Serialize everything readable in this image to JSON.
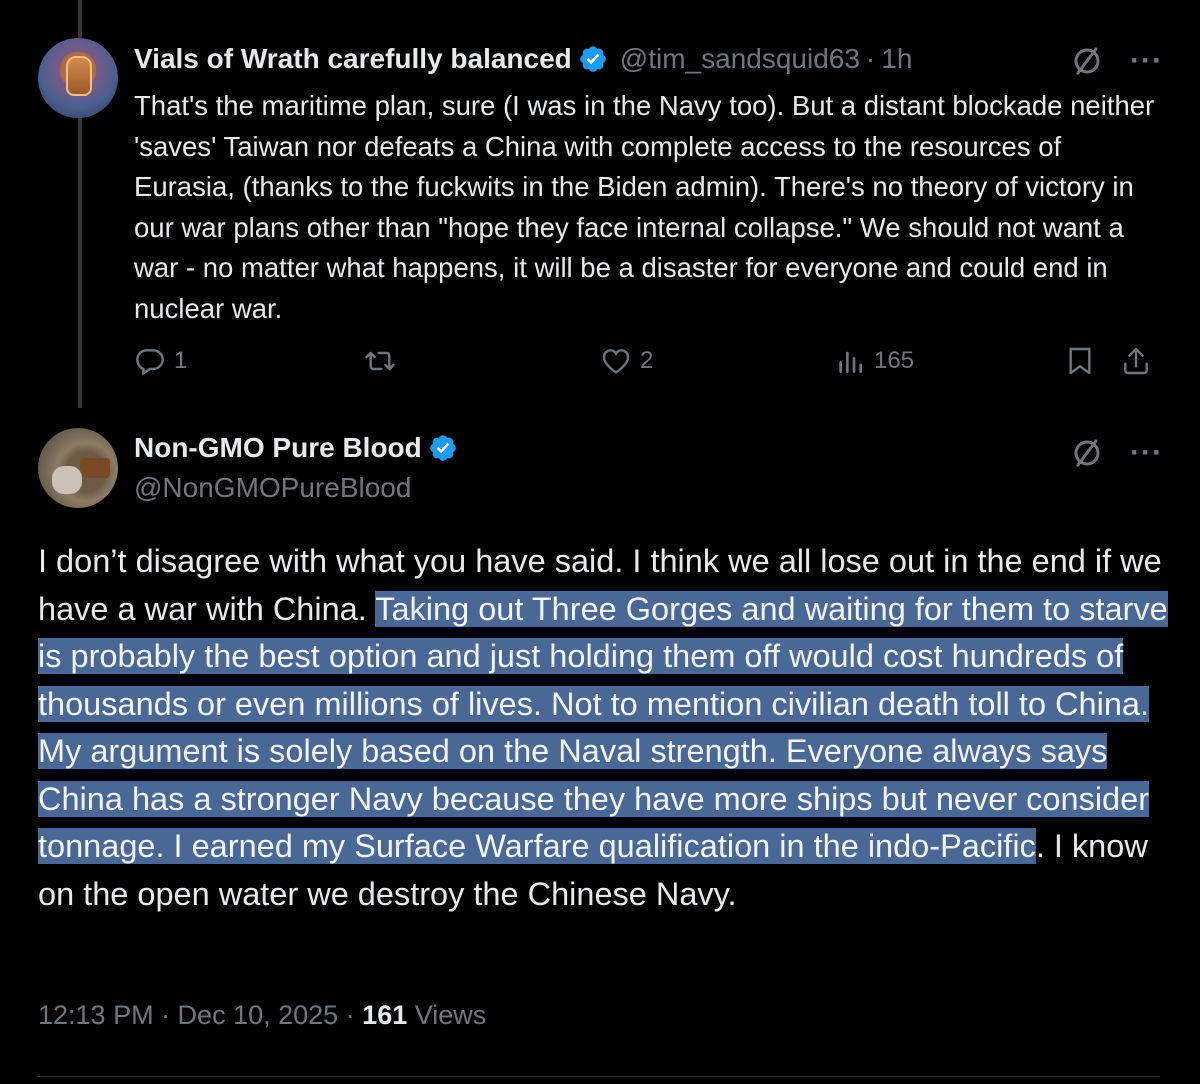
{
  "colors": {
    "background": "#000000",
    "text": "#e7e9ea",
    "muted": "#71767b",
    "verified_blue": "#1d9bf0",
    "highlight": "#4a6896"
  },
  "tweet1": {
    "author_name": "Vials of Wrath carefully balanced",
    "handle": "@tim_sandsquid63",
    "separator": "·",
    "time": "1h",
    "body": "That's the maritime plan, sure (I was in the Navy too). But a distant blockade neither 'saves' Taiwan nor defeats a China with complete access to the resources of Eurasia, (thanks to the fuckwits in the Biden admin). There's no theory of victory in our war plans other than \"hope they face internal collapse.\" We should not want a war - no matter what happens, it will be a disaster for everyone and could end in nuclear war.",
    "more": "···",
    "actions": {
      "reply_icon": "reply-icon",
      "replies": "1",
      "retweet_icon": "retweet-icon",
      "like_icon": "heart-icon",
      "likes": "2",
      "views_icon": "views-chart-icon",
      "views": "165",
      "bookmark_icon": "bookmark-icon",
      "share_icon": "share-icon"
    }
  },
  "tweet2": {
    "author_name": "Non-GMO Pure Blood",
    "handle": "@NonGMOPureBlood",
    "more": "···",
    "body_plain": "I don’t disagree with what you have said. I think we all lose out in the end if we have a war with China. ",
    "body_highlighted": "Taking out Three Gorges and waiting for them to starve is probably the best option and just holding them off would cost hundreds of thousands or even millions of lives. Not to mention civilian death toll to China.  My argument is solely based on the Naval strength. Everyone always says China has a stronger Navy because they have more ships but never consider tonnage. I earned my Surface Warfare qualification in the indo-Pacific",
    "body_tail": ". I know on the open water we destroy the Chinese Navy.",
    "timestamp": "12:13 PM · Dec 10, 2025 · ",
    "views_count": "161",
    "views_label": " Views"
  }
}
